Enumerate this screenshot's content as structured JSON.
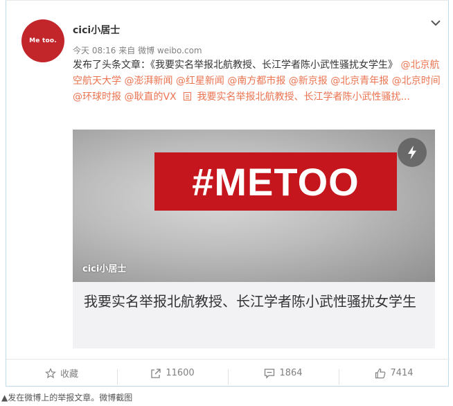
{
  "post": {
    "avatar_text": "Me too.",
    "username": "cici小居士",
    "time": "今天 08:16",
    "source_prefix": "来自",
    "source": "微博 weibo.com",
    "text_prefix": "发布了头条文章：《我要实名举报北航教授、长江学者陈小武性骚扰女学生》",
    "mentions": "@北京航空航天大学 @澎湃新闻 @红星新闻 @南方都市报 @新京报 @北京青年报 @北京时间 @环球时报 @耿直的VX",
    "article_link": "我要实名举报北航教授、长江学者陈小武性骚扰...",
    "article_icon": "article-icon"
  },
  "article": {
    "hero_text": "#METOO",
    "hero_author": "cici小居士",
    "title": "我要实名举报北航教授、长江学者陈小武性骚扰女学生"
  },
  "actions": {
    "favorite": "收藏",
    "repost_count": "11600",
    "comment_count": "1864",
    "like_count": "7414"
  },
  "caption": "▲发在微博上的举报文章。微博截图",
  "colors": {
    "link": "#eb7350",
    "metoo_red": "#c4161c",
    "avatar_red": "#c2262b"
  }
}
